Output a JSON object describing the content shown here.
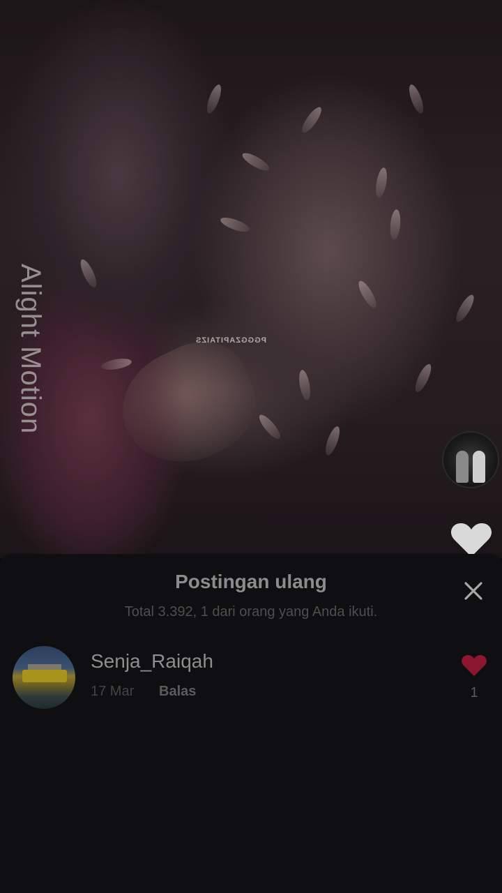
{
  "video": {
    "watermark": "Alight Motion",
    "overlay_text": "PGGGZAPITAIZS"
  },
  "sheet": {
    "title": "Postingan ulang",
    "subtitle": "Total 3.392, 1 dari orang yang Anda ikuti.",
    "close_icon": "close-icon"
  },
  "reposts": [
    {
      "username": "Senja_Raiqah",
      "date": "17 Mar",
      "reply_label": "Balas",
      "likes": "1"
    }
  ],
  "colors": {
    "sheet_bg": "#0f0f11",
    "like_red": "#8a1630",
    "text_primary": "#8e8e8e",
    "text_secondary": "#4e4e4e"
  }
}
